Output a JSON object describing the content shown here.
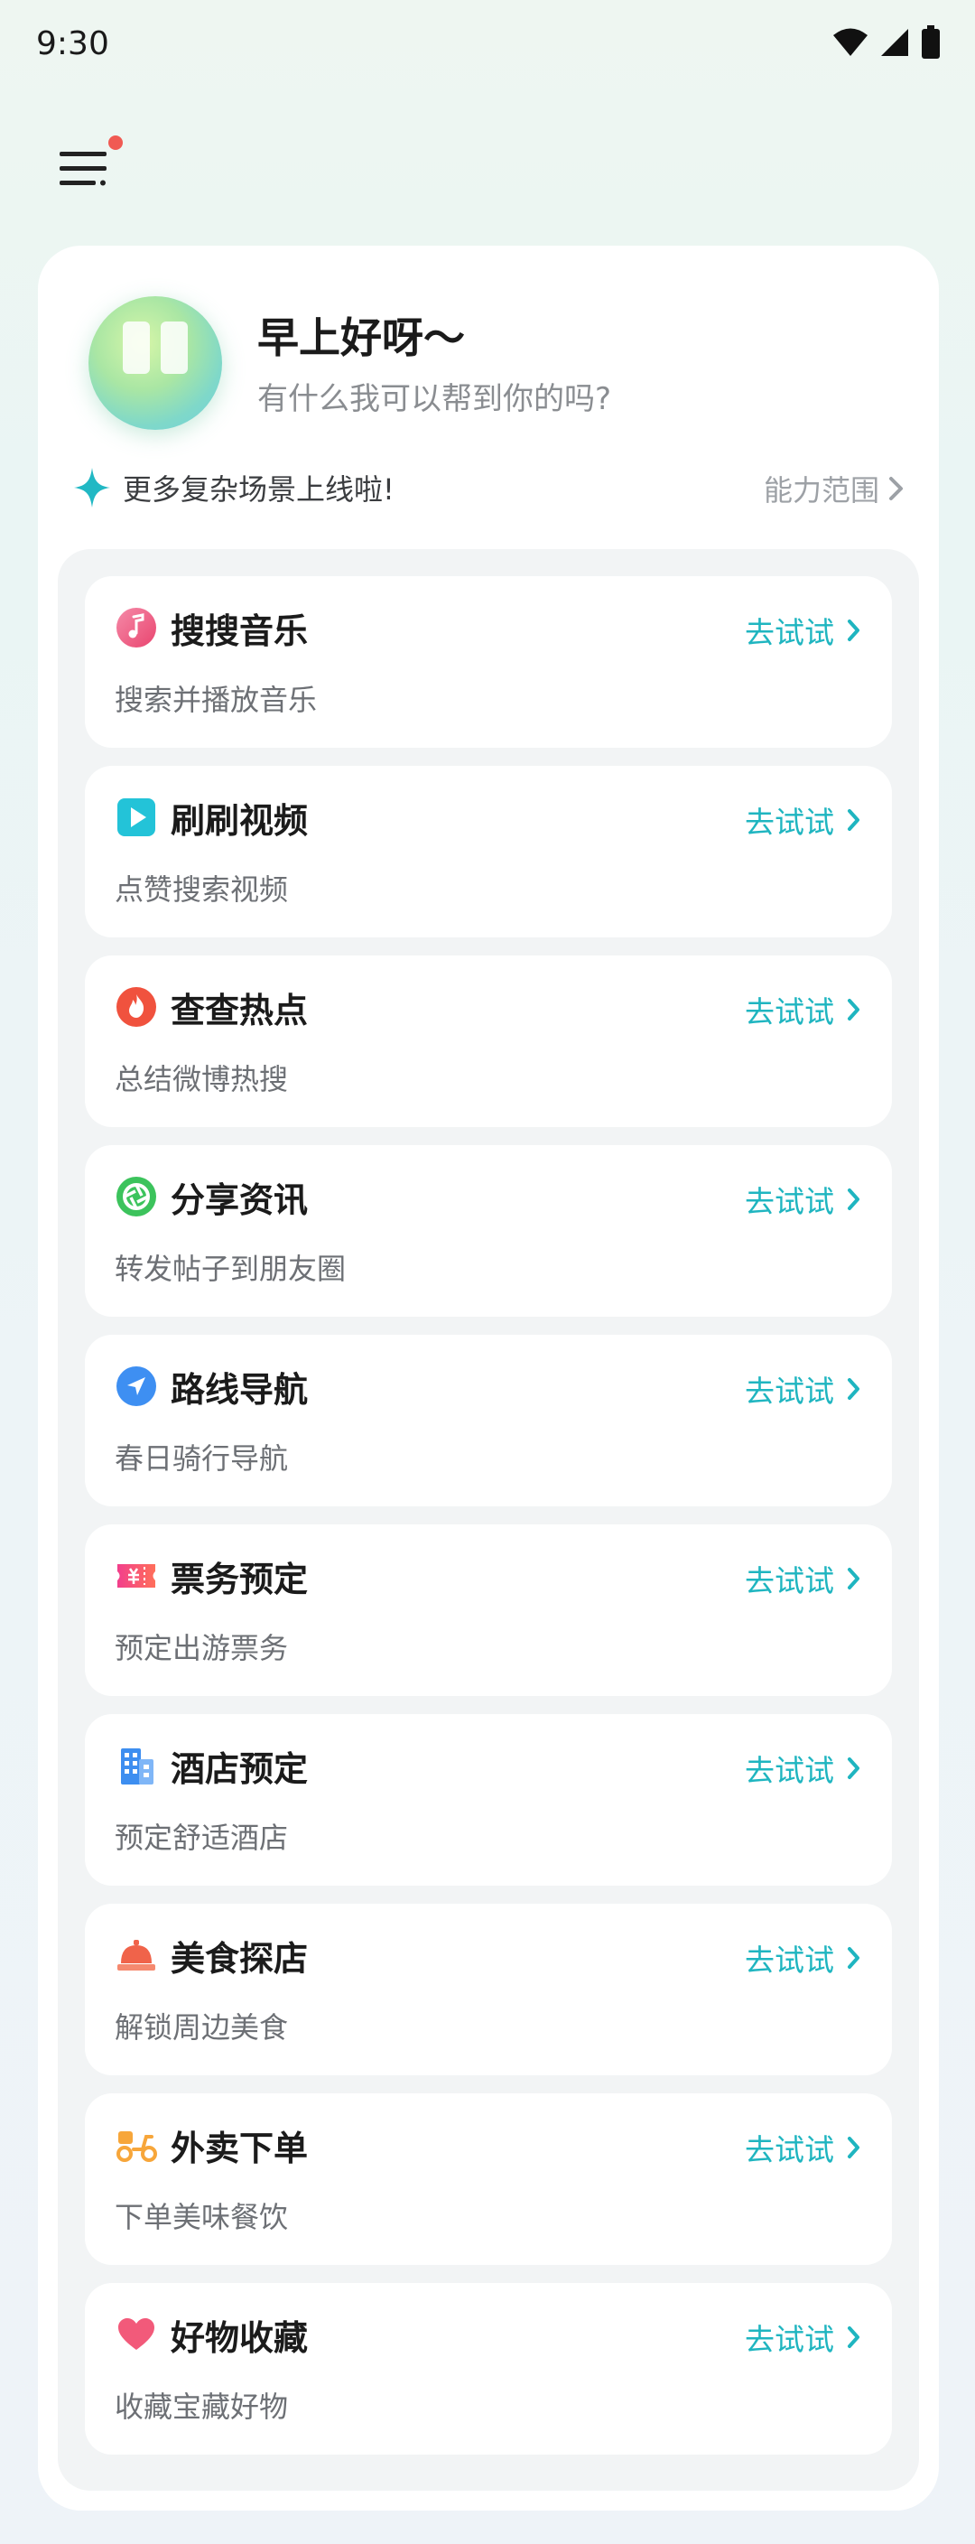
{
  "status_bar": {
    "time": "9:30"
  },
  "header": {
    "greeting_title": "早上好呀～",
    "greeting_subtitle": "有什么我可以帮到你的吗?"
  },
  "banner": {
    "text": "更多复杂场景上线啦!",
    "link_label": "能力范围"
  },
  "items": [
    {
      "title": "搜搜音乐",
      "desc": "搜索并播放音乐",
      "action": "去试试",
      "icon": "music-note-icon"
    },
    {
      "title": "刷刷视频",
      "desc": "点赞搜索视频",
      "action": "去试试",
      "icon": "play-video-icon"
    },
    {
      "title": "查查热点",
      "desc": "总结微博热搜",
      "action": "去试试",
      "icon": "flame-icon"
    },
    {
      "title": "分享资讯",
      "desc": "转发帖子到朋友圈",
      "action": "去试试",
      "icon": "aperture-icon"
    },
    {
      "title": "路线导航",
      "desc": "春日骑行导航",
      "action": "去试试",
      "icon": "navigation-arrow-icon"
    },
    {
      "title": "票务预定",
      "desc": "预定出游票务",
      "action": "去试试",
      "icon": "ticket-icon"
    },
    {
      "title": "酒店预定",
      "desc": "预定舒适酒店",
      "action": "去试试",
      "icon": "hotel-building-icon"
    },
    {
      "title": "美食探店",
      "desc": "解锁周边美食",
      "action": "去试试",
      "icon": "food-cloche-icon"
    },
    {
      "title": "外卖下单",
      "desc": "下单美味餐饮",
      "action": "去试试",
      "icon": "delivery-scooter-icon"
    },
    {
      "title": "好物收藏",
      "desc": "收藏宝藏好物",
      "action": "去试试",
      "icon": "heart-icon"
    }
  ],
  "colors": {
    "accent": "#1fb5c0",
    "notification_dot": "#f05a53"
  }
}
